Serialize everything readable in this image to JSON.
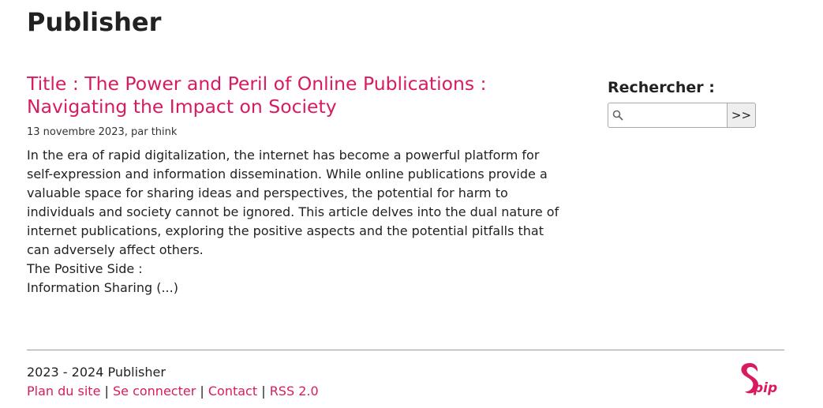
{
  "site": {
    "title": "Publisher"
  },
  "article": {
    "title": "Title : The Power and Peril of Online Publications : Navigating the Impact on Society",
    "meta": "13 novembre 2023, par think",
    "intro": "In the era of rapid digitalization, the internet has become a powerful platform for self-expression and information dissemination. While online publications provide a valuable space for sharing ideas and perspectives, the potential for harm to individuals and society cannot be ignored. This article delves into the dual nature of internet publications, exploring the positive aspects and the potential pitfalls that can adversely affect others.",
    "line2": "The Positive Side :",
    "line3": "Information Sharing (...)"
  },
  "search": {
    "label": "Rechercher :",
    "value": "",
    "button_label": ">>"
  },
  "footer": {
    "copyright": "2023 - 2024 Publisher",
    "links": {
      "plan": "Plan du site",
      "login": "Se connecter",
      "contact": "Contact",
      "rss": "RSS 2.0"
    },
    "separator": "|"
  },
  "colors": {
    "link": "#d81b60",
    "text": "#222222"
  },
  "icons": {
    "search": "magnifier-icon",
    "logo": "spip-logo"
  }
}
